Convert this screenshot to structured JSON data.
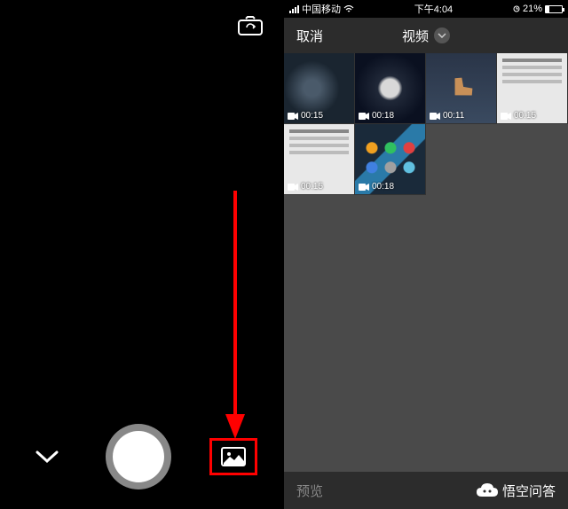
{
  "left": {
    "icons": {
      "switch_camera": "camera-switch-icon",
      "chevron": "chevron-down-icon",
      "gallery": "gallery-icon"
    }
  },
  "right": {
    "status": {
      "carrier": "中国移动",
      "time": "下午4:04",
      "battery_pct": "21%"
    },
    "nav": {
      "cancel": "取消",
      "title": "视频"
    },
    "thumbs": [
      {
        "duration": "00:15"
      },
      {
        "duration": "00:18"
      },
      {
        "duration": "00:11"
      },
      {
        "duration": "00:15"
      },
      {
        "duration": "00:15"
      },
      {
        "duration": "00:18"
      }
    ],
    "footer": {
      "preview": "预览",
      "watermark": "悟空问答"
    }
  }
}
